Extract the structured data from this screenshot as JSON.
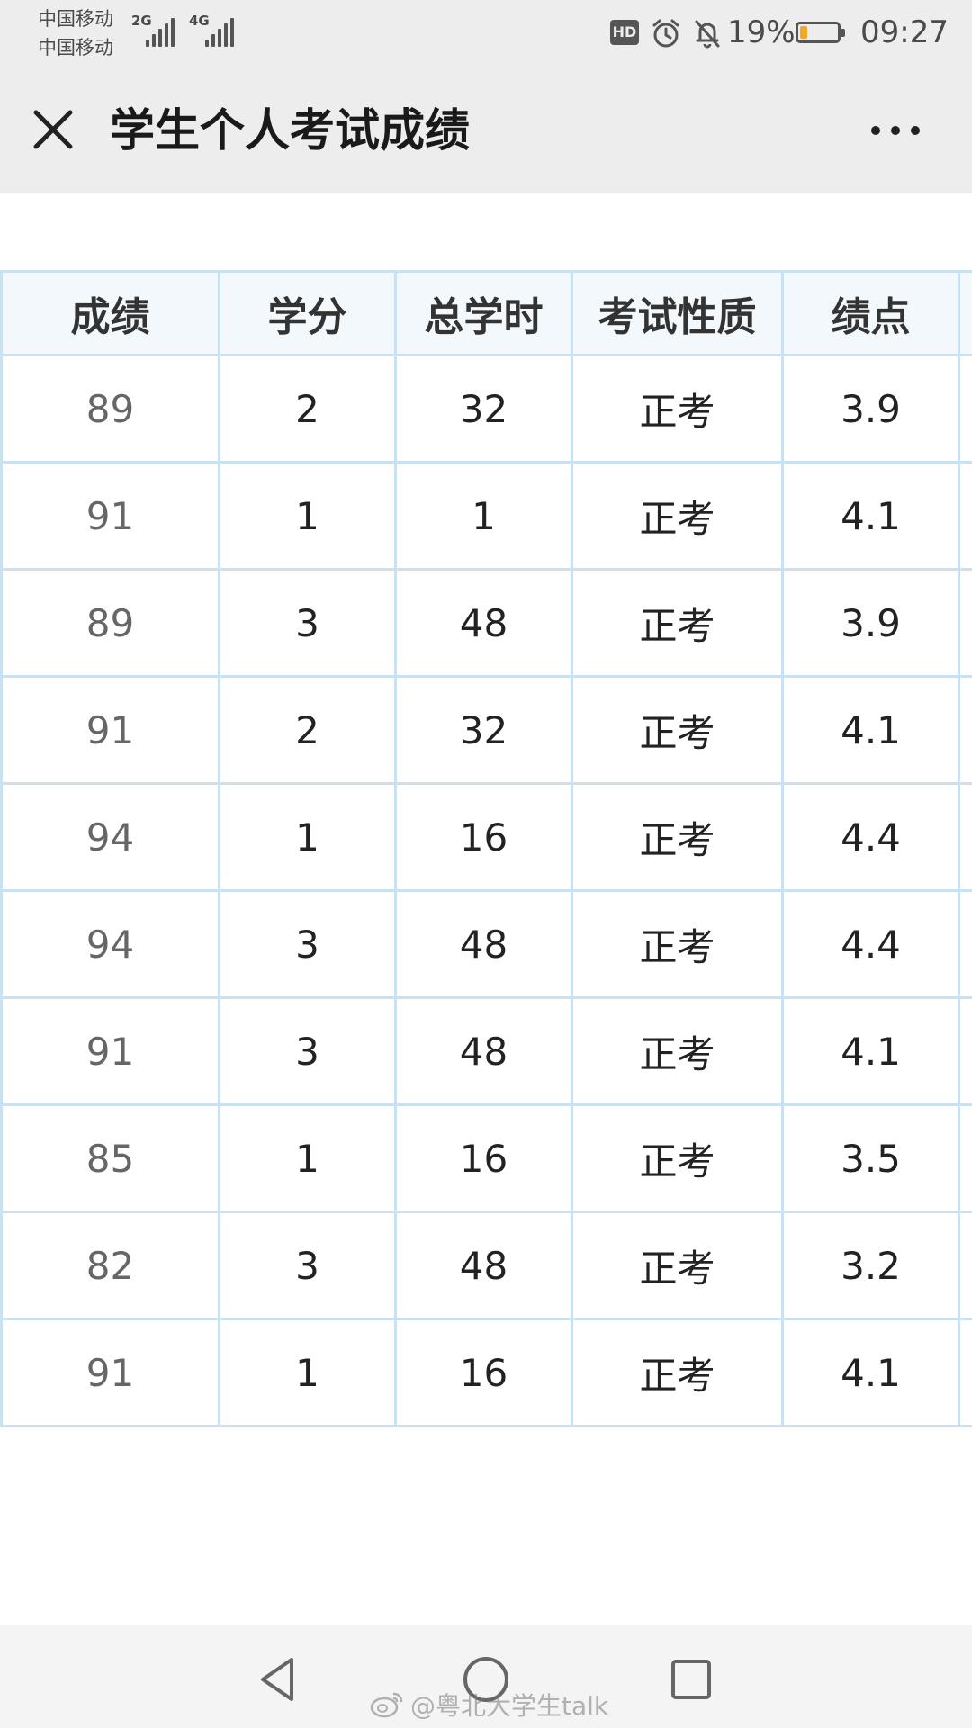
{
  "status_bar": {
    "carrier_1": "中国移动",
    "carrier_2": "中国移动",
    "net_1": "2G",
    "net_2": "4G",
    "hd": "HD",
    "battery_percent": "19%",
    "battery_level": 0.19,
    "time": "09:27",
    "icons": [
      "alarm-icon",
      "bell-off-icon"
    ]
  },
  "title_bar": {
    "title": "学生个人考试成绩",
    "icons": [
      "close-icon",
      "more-icon"
    ]
  },
  "table": {
    "headers": [
      "成绩",
      "学分",
      "总学时",
      "考试性质",
      "绩点"
    ],
    "rows": [
      [
        "89",
        "2",
        "32",
        "正考",
        "3.9"
      ],
      [
        "91",
        "1",
        "1",
        "正考",
        "4.1"
      ],
      [
        "89",
        "3",
        "48",
        "正考",
        "3.9"
      ],
      [
        "91",
        "2",
        "32",
        "正考",
        "4.1"
      ],
      [
        "94",
        "1",
        "16",
        "正考",
        "4.4"
      ],
      [
        "94",
        "3",
        "48",
        "正考",
        "4.4"
      ],
      [
        "91",
        "3",
        "48",
        "正考",
        "4.1"
      ],
      [
        "85",
        "1",
        "16",
        "正考",
        "3.5"
      ],
      [
        "82",
        "3",
        "48",
        "正考",
        "3.2"
      ],
      [
        "91",
        "1",
        "16",
        "正考",
        "4.1"
      ]
    ]
  },
  "nav_bar": {
    "icons": [
      "back-triangle-icon",
      "home-circle-icon",
      "recents-square-icon"
    ]
  },
  "watermark": {
    "text": "@粤北大学生talk",
    "icon": "weibo-icon"
  },
  "colors": {
    "bar_background": "#ededed",
    "table_border": "#c9e1f0",
    "header_background": "#f2f8fc",
    "battery_fill": "#f5a623"
  }
}
